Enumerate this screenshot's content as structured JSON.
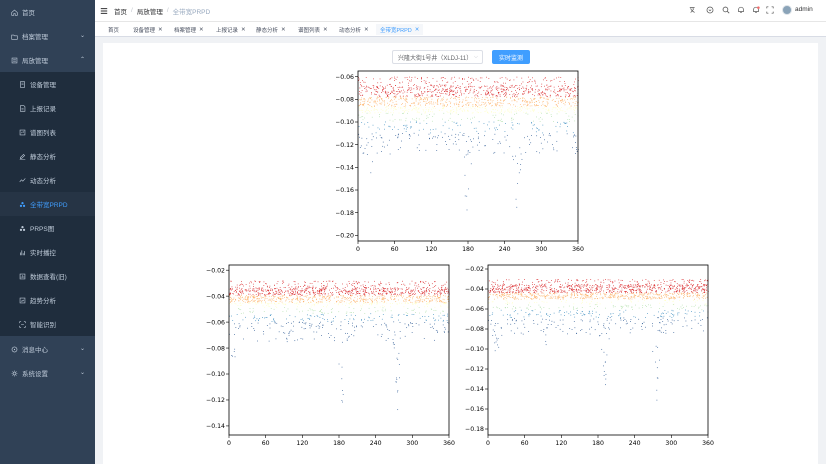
{
  "sidebar": {
    "items": [
      {
        "label": "首页",
        "icon": "home-icon",
        "kind": "top"
      },
      {
        "label": "档案管理",
        "icon": "folder-icon",
        "kind": "top",
        "arrow": "expand"
      },
      {
        "label": "局放管理",
        "icon": "list-icon",
        "kind": "top",
        "arrow": "collapse"
      },
      {
        "label": "设备管理",
        "icon": "device-icon",
        "kind": "sub"
      },
      {
        "label": "上报记录",
        "icon": "report-icon",
        "kind": "sub"
      },
      {
        "label": "谱图列表",
        "icon": "spectrum-list-icon",
        "kind": "sub"
      },
      {
        "label": "静态分析",
        "icon": "edit-icon",
        "kind": "sub"
      },
      {
        "label": "动态分析",
        "icon": "dynamic-icon",
        "kind": "sub"
      },
      {
        "label": "全带宽PRPD",
        "icon": "cluster-icon",
        "kind": "sub",
        "active": true
      },
      {
        "label": "PRPS图",
        "icon": "cluster-icon",
        "kind": "sub"
      },
      {
        "label": "实时播控",
        "icon": "bars-icon",
        "kind": "sub"
      },
      {
        "label": "数据查看(旧)",
        "icon": "data-icon",
        "kind": "sub"
      },
      {
        "label": "趋势分析",
        "icon": "trend-icon",
        "kind": "sub"
      },
      {
        "label": "智能识别",
        "icon": "scan-icon",
        "kind": "sub"
      },
      {
        "label": "消息中心",
        "icon": "message-icon",
        "kind": "top",
        "arrow": "expand"
      },
      {
        "label": "系统设置",
        "icon": "gear-icon",
        "kind": "top",
        "arrow": "expand"
      }
    ]
  },
  "navbar": {
    "breadcrumb": [
      "首页",
      "局放管理",
      "全带宽PRPD"
    ],
    "user": "admin",
    "icons": [
      "translate-icon",
      "github-icon",
      "search-icon",
      "bell-icon",
      "notification-icon",
      "fullscreen-icon"
    ]
  },
  "tags": [
    {
      "label": "首页",
      "closable": false
    },
    {
      "label": "设备管理",
      "closable": true
    },
    {
      "label": "档案管理",
      "closable": true
    },
    {
      "label": "上报记录",
      "closable": true
    },
    {
      "label": "静态分析",
      "closable": true
    },
    {
      "label": "谱图列表",
      "closable": true
    },
    {
      "label": "动态分析",
      "closable": true
    },
    {
      "label": "全带宽PRPD",
      "closable": true,
      "active": true
    }
  ],
  "controls": {
    "device_select": "兴隆大街1号井（XLDJ-11）",
    "realtime_button": "实时监测"
  },
  "colors": {
    "sidebar_bg": "#304156",
    "accent": "#409eff",
    "scatter_palette": [
      "#d7191c",
      "#fdae61",
      "#ffffbf",
      "#abdda4",
      "#2b83ba",
      "#1a4b8a"
    ]
  },
  "chart_data": [
    {
      "type": "scatter",
      "title": "",
      "xlim": [
        0,
        360
      ],
      "ylim": [
        -0.205,
        -0.055
      ],
      "xticks": [
        0,
        60,
        120,
        180,
        240,
        300,
        360
      ],
      "yticks": [
        -0.06,
        -0.08,
        -0.1,
        -0.12,
        -0.14,
        -0.16,
        -0.18,
        -0.2
      ],
      "ytick_labels": [
        "−0.06",
        "−0.08",
        "−0.10",
        "−0.12",
        "−0.14",
        "−0.16",
        "−0.18",
        "−0.20"
      ],
      "band_top": -0.06,
      "dense_band": [
        -0.067,
        -0.092
      ],
      "base_bottom": -0.118,
      "spikes": [
        {
          "x": 20,
          "bottom": -0.145
        },
        {
          "x": 178,
          "bottom": -0.19
        },
        {
          "x": 260,
          "bottom": -0.185
        }
      ]
    },
    {
      "type": "scatter",
      "title": "",
      "xlim": [
        0,
        360
      ],
      "ylim": [
        -0.147,
        -0.016
      ],
      "xticks": [
        0,
        60,
        120,
        180,
        240,
        300,
        360
      ],
      "yticks": [
        -0.02,
        -0.04,
        -0.06,
        -0.08,
        -0.1,
        -0.12,
        -0.14
      ],
      "ytick_labels": [
        "−0.02",
        "−0.04",
        "−0.06",
        "−0.08",
        "−0.10",
        "−0.12",
        "−0.14"
      ],
      "band_top": -0.028,
      "dense_band": [
        -0.033,
        -0.046
      ],
      "base_bottom": -0.065,
      "spikes": [
        {
          "x": 8,
          "bottom": -0.095
        },
        {
          "x": 95,
          "bottom": -0.075
        },
        {
          "x": 185,
          "bottom": -0.135
        },
        {
          "x": 275,
          "bottom": -0.13
        }
      ]
    },
    {
      "type": "scatter",
      "title": "",
      "xlim": [
        0,
        360
      ],
      "ylim": [
        -0.186,
        -0.016
      ],
      "xticks": [
        0,
        60,
        120,
        180,
        240,
        300,
        360
      ],
      "yticks": [
        -0.02,
        -0.04,
        -0.06,
        -0.08,
        -0.1,
        -0.12,
        -0.14,
        -0.16,
        -0.18
      ],
      "ytick_labels": [
        "−0.02",
        "−0.04",
        "−0.06",
        "−0.08",
        "−0.10",
        "−0.12",
        "−0.14",
        "−0.16",
        "−0.18"
      ],
      "band_top": -0.03,
      "dense_band": [
        -0.035,
        -0.05
      ],
      "base_bottom": -0.075,
      "spikes": [
        {
          "x": 15,
          "bottom": -0.115
        },
        {
          "x": 95,
          "bottom": -0.09
        },
        {
          "x": 190,
          "bottom": -0.15
        },
        {
          "x": 275,
          "bottom": -0.16
        }
      ]
    }
  ]
}
